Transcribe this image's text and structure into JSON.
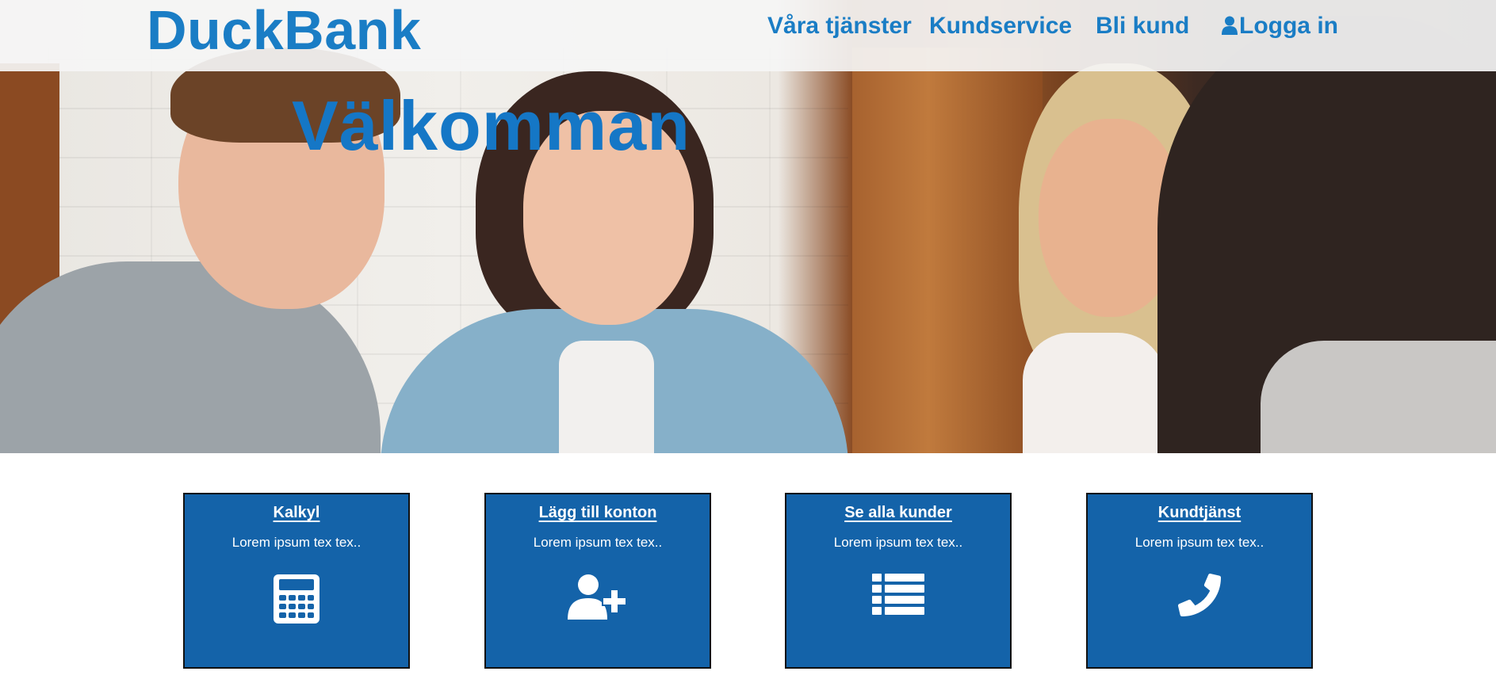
{
  "header": {
    "brand": "DuckBank",
    "nav": [
      {
        "label": "Våra tjänster"
      },
      {
        "label": "Kundservice"
      },
      {
        "label": "Bli kund"
      },
      {
        "label": "Logga in",
        "icon": "user-icon"
      }
    ]
  },
  "hero": {
    "title": "Välkomman"
  },
  "cards": [
    {
      "title": "Kalkyl",
      "text": "Lorem ipsum tex tex..",
      "icon": "calculator-icon"
    },
    {
      "title": "Lägg till konton",
      "text": "Lorem ipsum tex tex..",
      "icon": "add-user-icon"
    },
    {
      "title": "Se alla kunder",
      "text": "Lorem ipsum tex tex..",
      "icon": "list-icon"
    },
    {
      "title": "Kundtjänst",
      "text": "Lorem ipsum tex tex..",
      "icon": "phone-icon"
    }
  ],
  "colors": {
    "brand": "#1a7dc5",
    "card_bg": "#1463a9",
    "header_bg": "#f5f5f5"
  }
}
